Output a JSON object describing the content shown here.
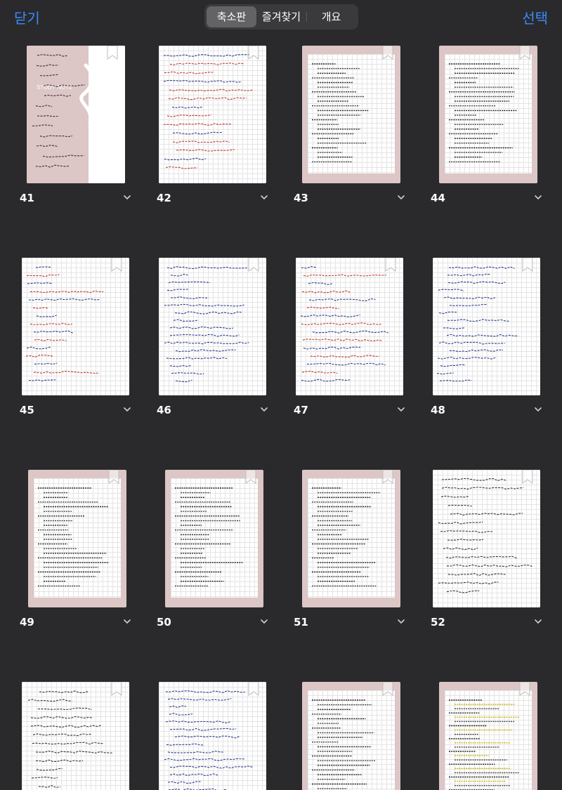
{
  "toolbar": {
    "close_label": "닫기",
    "select_label": "선택",
    "tabs": [
      {
        "label": "축소판",
        "active": true
      },
      {
        "label": "즐겨찾기",
        "active": false
      },
      {
        "label": "개요",
        "active": false
      }
    ]
  },
  "colors": {
    "accent": "#3d8bfd",
    "background": "#2a2a2c",
    "frame_pink": "#dcc6c6"
  },
  "pages": [
    {
      "number": "41",
      "style": "cover"
    },
    {
      "number": "42",
      "style": "handwritten-red"
    },
    {
      "number": "43",
      "style": "typed-pink"
    },
    {
      "number": "44",
      "style": "typed-pink"
    },
    {
      "number": "45",
      "style": "handwritten-mixed"
    },
    {
      "number": "46",
      "style": "handwritten-blue"
    },
    {
      "number": "47",
      "style": "handwritten-mixed"
    },
    {
      "number": "48",
      "style": "handwritten-blue"
    },
    {
      "number": "49",
      "style": "typed-pink"
    },
    {
      "number": "50",
      "style": "typed-pink"
    },
    {
      "number": "51",
      "style": "typed-pink"
    },
    {
      "number": "52",
      "style": "handwritten-dark"
    },
    {
      "number": "",
      "style": "handwritten-dark"
    },
    {
      "number": "",
      "style": "handwritten-blue"
    },
    {
      "number": "",
      "style": "typed-pink"
    },
    {
      "number": "",
      "style": "typed-pink-highlight"
    }
  ],
  "cover": {
    "title": "STUDY NOTE"
  },
  "icons": {
    "page_menu": "chevron-down-icon",
    "bookmark": "bookmark-icon"
  }
}
